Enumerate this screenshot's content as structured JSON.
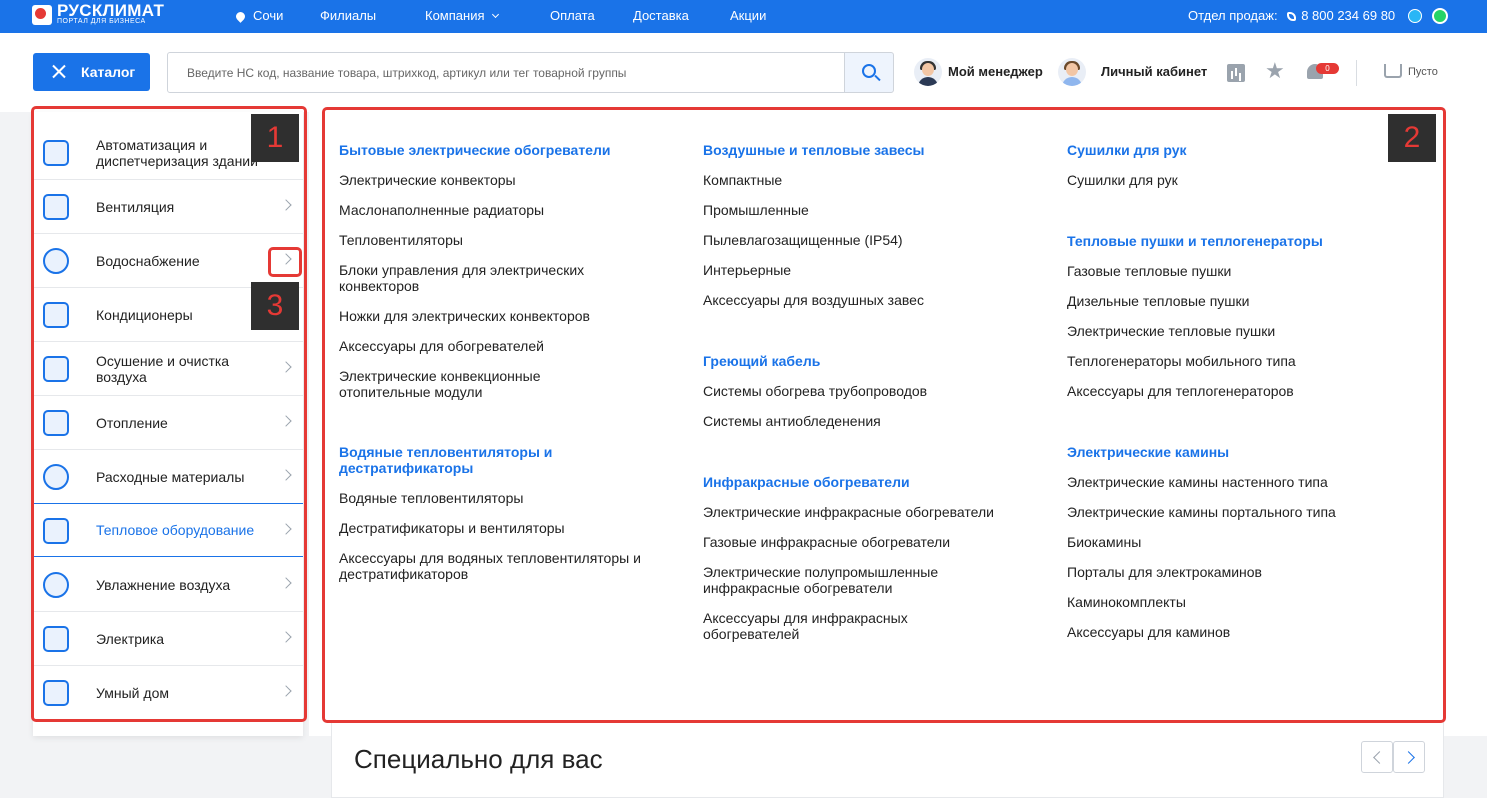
{
  "topbar": {
    "brand": "РУСКЛИМАТ",
    "brand_sub": "ПОРТАЛ ДЛЯ БИЗНЕСА",
    "city": "Сочи",
    "nav": [
      "Филиалы",
      "Компания",
      "Оплата",
      "Доставка",
      "Акции"
    ],
    "sales_label": "Отдел продаж:",
    "phone": "8 800 234 69 80"
  },
  "header": {
    "catalog_label": "Каталог",
    "search_placeholder": "Введите НС код, название товара, штрихкод, артикул или тег товарной группы",
    "manager_label": "Мой менеджер",
    "account_label": "Личный кабинет",
    "notifications_count": "0",
    "cart_label": "Пусто"
  },
  "sidebar": {
    "items": [
      {
        "label": "Автоматизация и диспетчеризация зданий"
      },
      {
        "label": "Вентиляция"
      },
      {
        "label": "Водоснабжение"
      },
      {
        "label": "Кондиционеры"
      },
      {
        "label": "Осушение и очистка воздуха"
      },
      {
        "label": "Отопление"
      },
      {
        "label": "Расходные материалы"
      },
      {
        "label": "Тепловое оборудование"
      },
      {
        "label": "Увлажнение воздуха"
      },
      {
        "label": "Электрика"
      },
      {
        "label": "Умный дом"
      }
    ]
  },
  "panel": {
    "columns": [
      [
        {
          "title": "Бытовые электрические обогреватели",
          "items": [
            "Электрические конвекторы",
            "Маслонаполненные радиаторы",
            "Тепловентиляторы",
            "Блоки управления для электрических конвекторов",
            "Ножки для электрических конвекторов",
            "Аксессуары для обогревателей",
            "Электрические конвекционные отопительные модули"
          ]
        },
        {
          "title": "Водяные тепловентиляторы и дестратификаторы",
          "items": [
            "Водяные тепловентиляторы",
            "Дестратификаторы и вентиляторы",
            "Аксессуары для водяных тепловентиляторы и дестратификаторов"
          ]
        }
      ],
      [
        {
          "title": "Воздушные и тепловые завесы",
          "items": [
            "Компактные",
            "Промышленные",
            "Пылевлагозащищенные (IP54)",
            "Интерьерные",
            "Аксессуары для воздушных завес"
          ]
        },
        {
          "title": "Греющий кабель",
          "items": [
            "Системы обогрева трубопроводов",
            "Системы антиобледенения"
          ]
        },
        {
          "title": "Инфракрасные обогреватели",
          "items": [
            "Электрические инфракрасные обогреватели",
            "Газовые инфракрасные обогреватели",
            "Электрические полупромышленные инфракрасные обогреватели",
            "Аксессуары для инфракрасных обогревателей"
          ]
        }
      ],
      [
        {
          "title": "Сушилки для рук",
          "items": [
            "Сушилки для рук"
          ]
        },
        {
          "title": "Тепловые пушки и теплогенераторы",
          "items": [
            "Газовые тепловые пушки",
            "Дизельные тепловые пушки",
            "Электрические тепловые пушки",
            "Теплогенераторы мобильного типа",
            "Аксессуары для теплогенераторов"
          ]
        },
        {
          "title": "Электрические камины",
          "items": [
            "Электрические камины настенного типа",
            "Электрические камины портального типа",
            "Биокамины",
            "Порталы для электрокаминов",
            "Каминокомплекты",
            "Аксессуары для каминов"
          ]
        }
      ]
    ]
  },
  "special": {
    "title": "Специально для вас"
  },
  "annotations": [
    "1",
    "2",
    "3"
  ],
  "colors": {
    "accent": "#1a73e8",
    "annotation": "#e53935",
    "label_bg": "#2f2f2f"
  }
}
